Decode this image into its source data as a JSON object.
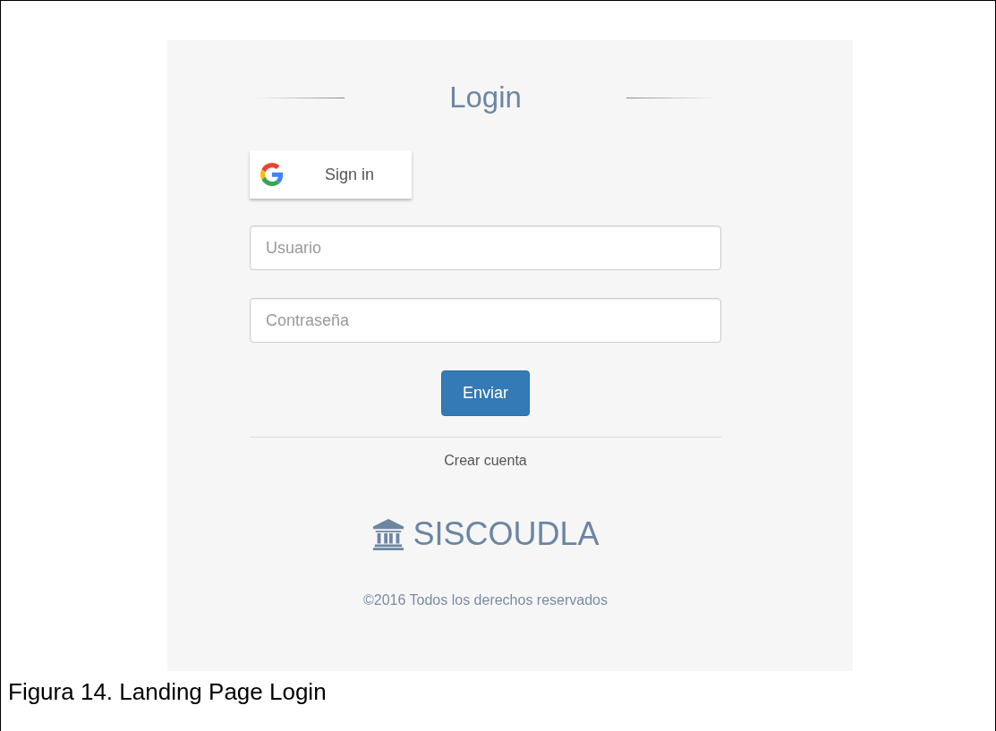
{
  "login_panel": {
    "title": "Login",
    "google_button": {
      "label": "Sign in"
    },
    "fields": [
      {
        "placeholder": "Usuario"
      },
      {
        "placeholder": "Contraseña"
      }
    ],
    "submit_button": "Enviar",
    "create_account_link": "Crear cuenta",
    "brand": "SISCOUDLA",
    "copyright": "©2016 Todos los derechos reservados"
  },
  "caption": "Figura 14. Landing Page Login"
}
